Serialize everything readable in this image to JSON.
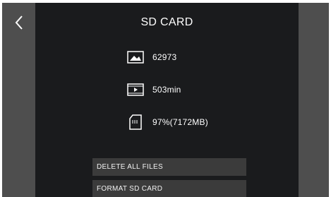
{
  "screen": {
    "title": "SD CARD"
  },
  "nav": {
    "back_icon": "chevron-left-icon"
  },
  "info": [
    {
      "icon": "photo-icon",
      "value": "62973"
    },
    {
      "icon": "video-icon",
      "value": "503min"
    },
    {
      "icon": "sd-card-icon",
      "value": "97%(7172MB)"
    }
  ],
  "actions": {
    "delete_all_label": "DELETE ALL FILES",
    "format_label": "FORMAT SD CARD"
  },
  "colors": {
    "background": "#1a1b1d",
    "side_panels": "#4e4e4e",
    "button": "#3b3b3b",
    "text": "#ffffff"
  }
}
